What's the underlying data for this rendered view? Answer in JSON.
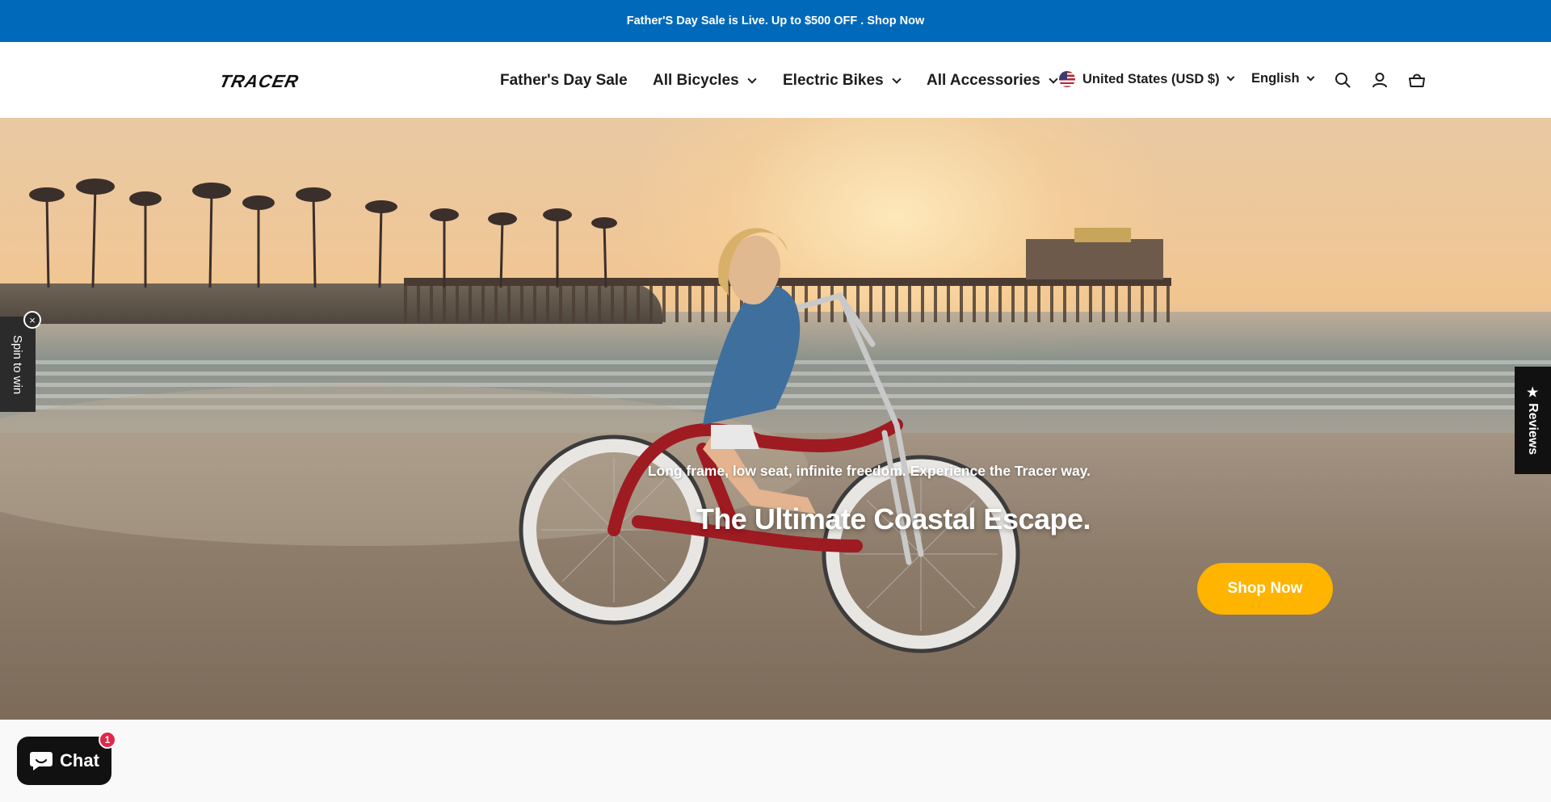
{
  "announcement": {
    "text": "Father'S Day Sale is Live. Up to $500 OFF . Shop Now"
  },
  "header": {
    "logo": "TRACER",
    "nav": [
      {
        "label": "Father's Day Sale"
      },
      {
        "label": "All Bicycles"
      },
      {
        "label": "Electric Bikes"
      },
      {
        "label": "All Accessories"
      }
    ],
    "country": "United States (USD $)",
    "language": "English",
    "icons": [
      "search-icon",
      "account-icon",
      "cart-icon"
    ]
  },
  "hero": {
    "subtitle": "Long frame, low seat, infinite freedom. Experience the Tracer way.",
    "title": "The Ultimate Coastal Escape.",
    "button": "Shop Now"
  },
  "spin_widget": {
    "label": "Spin to win",
    "close": "×"
  },
  "reviews_tab": {
    "label": "Reviews",
    "star": "★"
  },
  "chat": {
    "label": "Chat",
    "badge": "1"
  },
  "colors": {
    "announcement_bg": "#0069b9",
    "cta": "#ffb400",
    "badge": "#e0284a"
  }
}
